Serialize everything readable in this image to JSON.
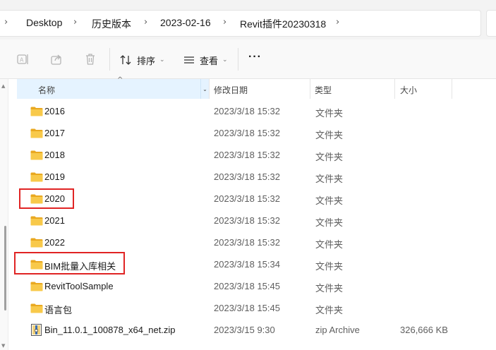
{
  "breadcrumb": {
    "items": [
      "Desktop",
      "历史版本",
      "2023-02-16",
      "Revit插件20230318"
    ]
  },
  "toolbar": {
    "sort_label": "排序",
    "view_label": "查看",
    "more_label": "···"
  },
  "columns": {
    "name": "名称",
    "date": "修改日期",
    "type": "类型",
    "size": "大小"
  },
  "files": [
    {
      "name": "2016",
      "date": "2023/3/18 15:32",
      "type": "文件夹",
      "size": "",
      "icon": "folder-icon"
    },
    {
      "name": "2017",
      "date": "2023/3/18 15:32",
      "type": "文件夹",
      "size": "",
      "icon": "folder-icon"
    },
    {
      "name": "2018",
      "date": "2023/3/18 15:32",
      "type": "文件夹",
      "size": "",
      "icon": "folder-icon"
    },
    {
      "name": "2019",
      "date": "2023/3/18 15:32",
      "type": "文件夹",
      "size": "",
      "icon": "folder-icon"
    },
    {
      "name": "2020",
      "date": "2023/3/18 15:32",
      "type": "文件夹",
      "size": "",
      "icon": "folder-icon"
    },
    {
      "name": "2021",
      "date": "2023/3/18 15:32",
      "type": "文件夹",
      "size": "",
      "icon": "folder-icon"
    },
    {
      "name": "2022",
      "date": "2023/3/18 15:32",
      "type": "文件夹",
      "size": "",
      "icon": "folder-icon"
    },
    {
      "name": "BIM批量入库相关",
      "date": "2023/3/18 15:34",
      "type": "文件夹",
      "size": "",
      "icon": "folder-icon"
    },
    {
      "name": "RevitToolSample",
      "date": "2023/3/18 15:45",
      "type": "文件夹",
      "size": "",
      "icon": "folder-icon"
    },
    {
      "name": "语言包",
      "date": "2023/3/18 15:45",
      "type": "文件夹",
      "size": "",
      "icon": "folder-icon"
    },
    {
      "name": "Bin_11.0.1_100878_x64_net.zip",
      "date": "2023/3/15 9:30",
      "type": "zip Archive",
      "size": "326,666 KB",
      "icon": "zip-archive-icon"
    }
  ],
  "colors": {
    "highlight_border": "#e02424",
    "folder_yellow": "#f8c94a",
    "header_selected": "#e5f3ff"
  }
}
